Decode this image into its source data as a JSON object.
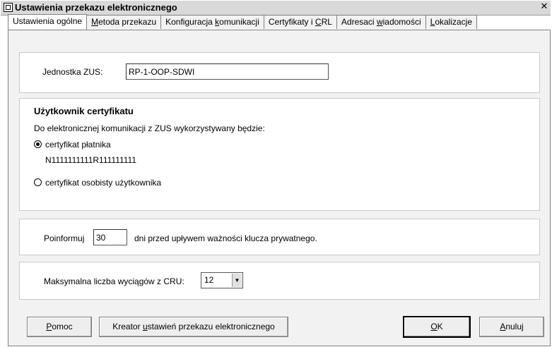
{
  "window": {
    "title": "Ustawienia przekazu elektronicznego",
    "close_glyph": "✕"
  },
  "tabs": [
    {
      "label": "Ustawienia ogólne",
      "u": ""
    },
    {
      "pre": "",
      "u": "M",
      "post": "etoda przekazu"
    },
    {
      "pre": "Konfiguracja ",
      "u": "k",
      "post": "omunikacji"
    },
    {
      "pre": "Certyfikaty i ",
      "u": "C",
      "post": "RL"
    },
    {
      "pre": "Adresaci ",
      "u": "w",
      "post": "iadomości"
    },
    {
      "pre": "",
      "u": "L",
      "post": "okalizacje"
    }
  ],
  "zus": {
    "label": "Jednostka ZUS:",
    "value": "RP-1-OOP-SDWI"
  },
  "cert": {
    "heading": "Użytkownik certyfikatu",
    "description": "Do elektronicznej komunikacji z ZUS wykorzystywany będzie:",
    "option1_label": "certyfikat płatnika",
    "option1_id": "N1111111111R111111111",
    "option2_label": "certyfikat osobisty użytkownika"
  },
  "notify": {
    "label_before": "Poinformuj",
    "value": "30",
    "label_after": "dni przed upływem ważności klucza prywatnego."
  },
  "extracts": {
    "label": "Maksymalna liczba wyciągów z CRU:",
    "value": "12",
    "arrow": "▼"
  },
  "buttons": {
    "help": {
      "pre": "",
      "u": "P",
      "post": "omoc"
    },
    "wizard": {
      "pre": "Kreator ",
      "u": "u",
      "post": "stawień przekazu elektronicznego"
    },
    "ok": {
      "pre": "",
      "u": "O",
      "post": "K"
    },
    "cancel": {
      "pre": "",
      "u": "A",
      "post": "nuluj"
    }
  }
}
